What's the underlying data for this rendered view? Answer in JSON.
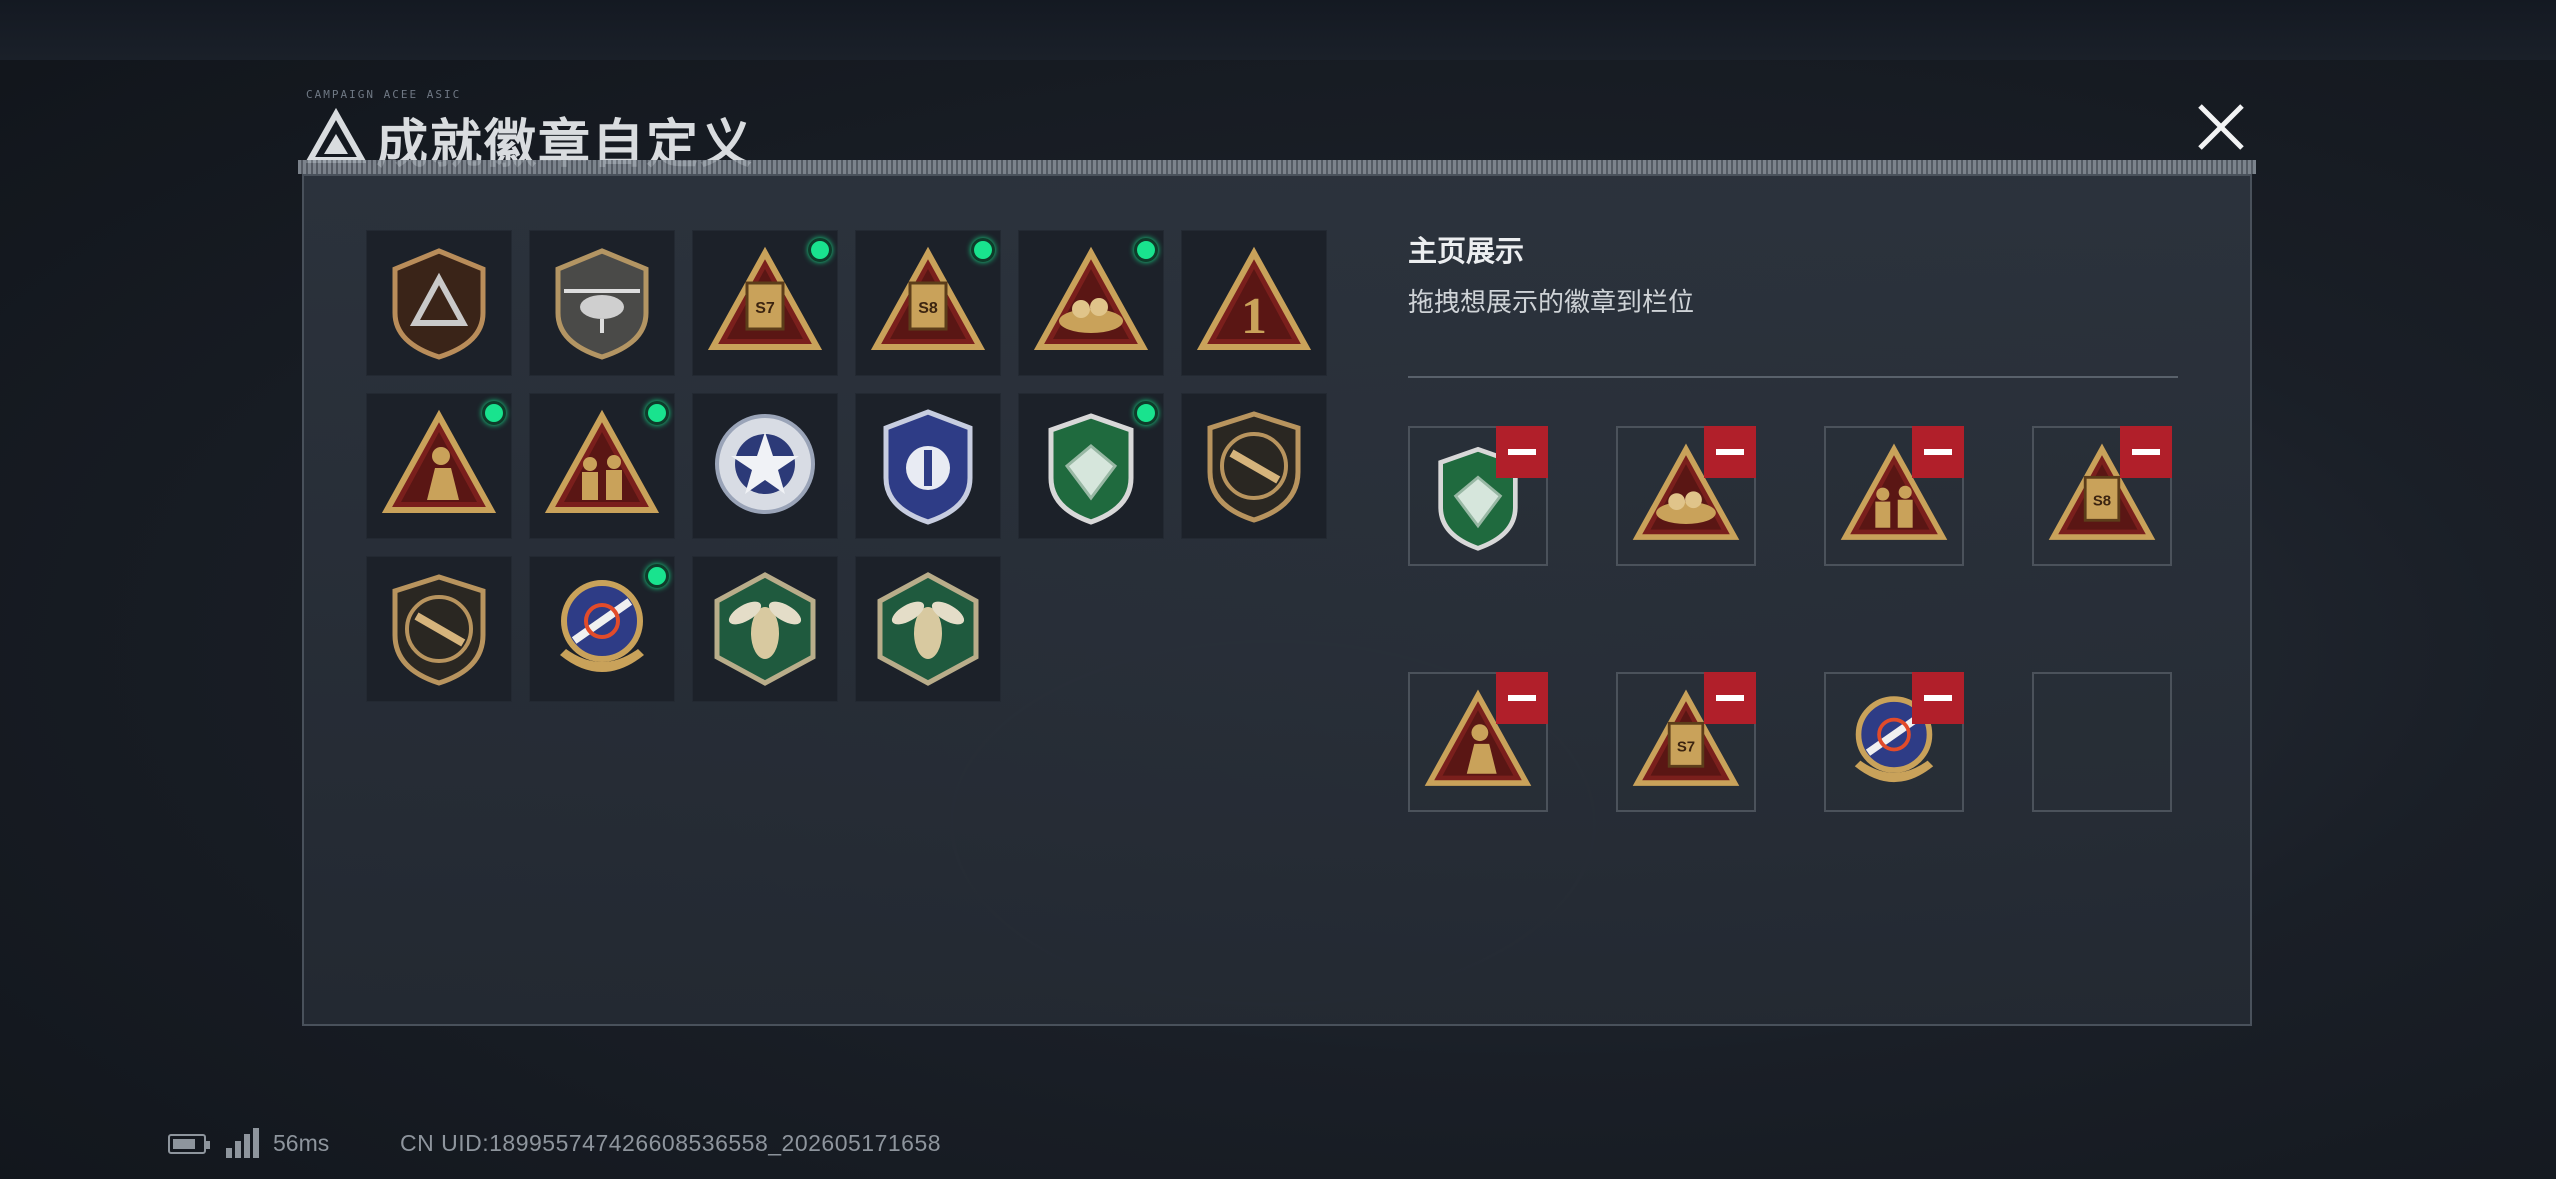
{
  "header": {
    "title": "成就徽章自定义",
    "deco_text": "CAMPAIGN  ACEE  ASIC"
  },
  "colors": {
    "owned_indicator": "#19e38e",
    "remove_button": "#b11f2a",
    "panel_bg": "#2d343e",
    "badge_gold": "#c9a25a"
  },
  "badges": [
    {
      "icon": "triangle-emblem-shield-badge",
      "new": false
    },
    {
      "icon": "helicopter-shield-badge",
      "new": false
    },
    {
      "icon": "ammo-box-s7-triangle-badge",
      "new": true,
      "text": "S7"
    },
    {
      "icon": "ammo-box-s8-triangle-badge",
      "new": true,
      "text": "S8"
    },
    {
      "icon": "nest-eggs-triangle-badge",
      "new": true
    },
    {
      "icon": "number-one-triangle-badge",
      "new": false,
      "text": "1"
    },
    {
      "icon": "kneeling-soldier-triangle-badge",
      "new": true
    },
    {
      "icon": "squad-soldiers-triangle-badge",
      "new": true
    },
    {
      "icon": "blue-star-wreath-badge",
      "new": false
    },
    {
      "icon": "blue-wing-shield-badge",
      "new": false
    },
    {
      "icon": "green-diamond-shield-badge",
      "new": true
    },
    {
      "icon": "rifle-round-shield-badge",
      "new": false
    },
    {
      "icon": "smg-round-shield-badge",
      "new": false
    },
    {
      "icon": "crossed-rockets-laurel-badge",
      "new": true
    },
    {
      "icon": "hornet-hexagon-badge",
      "new": false
    },
    {
      "icon": "hornet-hexagon-badge-alt",
      "new": false
    }
  ],
  "showcase": {
    "title": "主页展示",
    "subtitle": "拖拽想展示的徽章到栏位",
    "slots": [
      {
        "icon": "green-diamond-shield-badge",
        "filled": true
      },
      {
        "icon": "nest-eggs-triangle-badge",
        "filled": true
      },
      {
        "icon": "squad-soldiers-triangle-badge",
        "filled": true
      },
      {
        "icon": "ammo-box-s8-triangle-badge",
        "filled": true,
        "text": "S8"
      },
      {
        "icon": "kneeling-soldier-triangle-badge",
        "filled": true
      },
      {
        "icon": "ammo-box-s7-triangle-badge",
        "filled": true,
        "text": "S7"
      },
      {
        "icon": "crossed-rockets-laurel-badge",
        "filled": true
      },
      {
        "icon": "empty-slot",
        "filled": false
      }
    ]
  },
  "status_bar": {
    "ping": "56ms",
    "uid": "CN UID:1899557474266085365​58_202605171658"
  }
}
